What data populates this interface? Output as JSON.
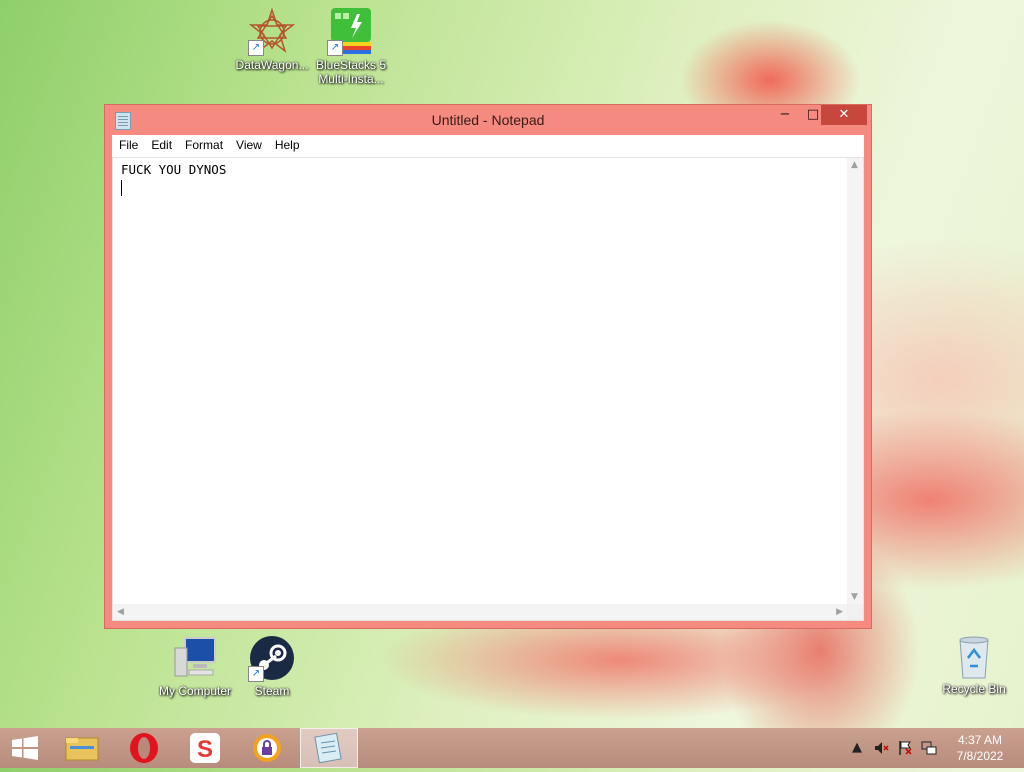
{
  "desktop": {
    "icons": [
      {
        "label": "DataWagon..."
      },
      {
        "label": "BlueStacks 5 Multi-Insta..."
      },
      {
        "label": "My Computer"
      },
      {
        "label": "Steam"
      },
      {
        "label": "Recycle Bin"
      }
    ]
  },
  "notepad": {
    "title": "Untitled - Notepad",
    "menu": [
      "File",
      "Edit",
      "Format",
      "View",
      "Help"
    ],
    "content": "FUCK YOU DYNOS",
    "controls": {
      "minimize": "−",
      "maximize": "□",
      "close": "✕"
    }
  },
  "taskbar": {
    "items": [
      {
        "icon": "windows-start-icon"
      },
      {
        "icon": "file-explorer-icon"
      },
      {
        "icon": "opera-icon"
      },
      {
        "icon": "app-s-icon"
      },
      {
        "icon": "vpn-lock-icon"
      },
      {
        "icon": "notepad-icon",
        "active": true
      }
    ],
    "tray": {
      "chevron": "▲",
      "time": "4:37 AM",
      "date": "7/8/2022"
    }
  },
  "colors": {
    "window_frame": "#f48a80",
    "close_button": "#c7473c",
    "taskbar": "#c09584"
  }
}
